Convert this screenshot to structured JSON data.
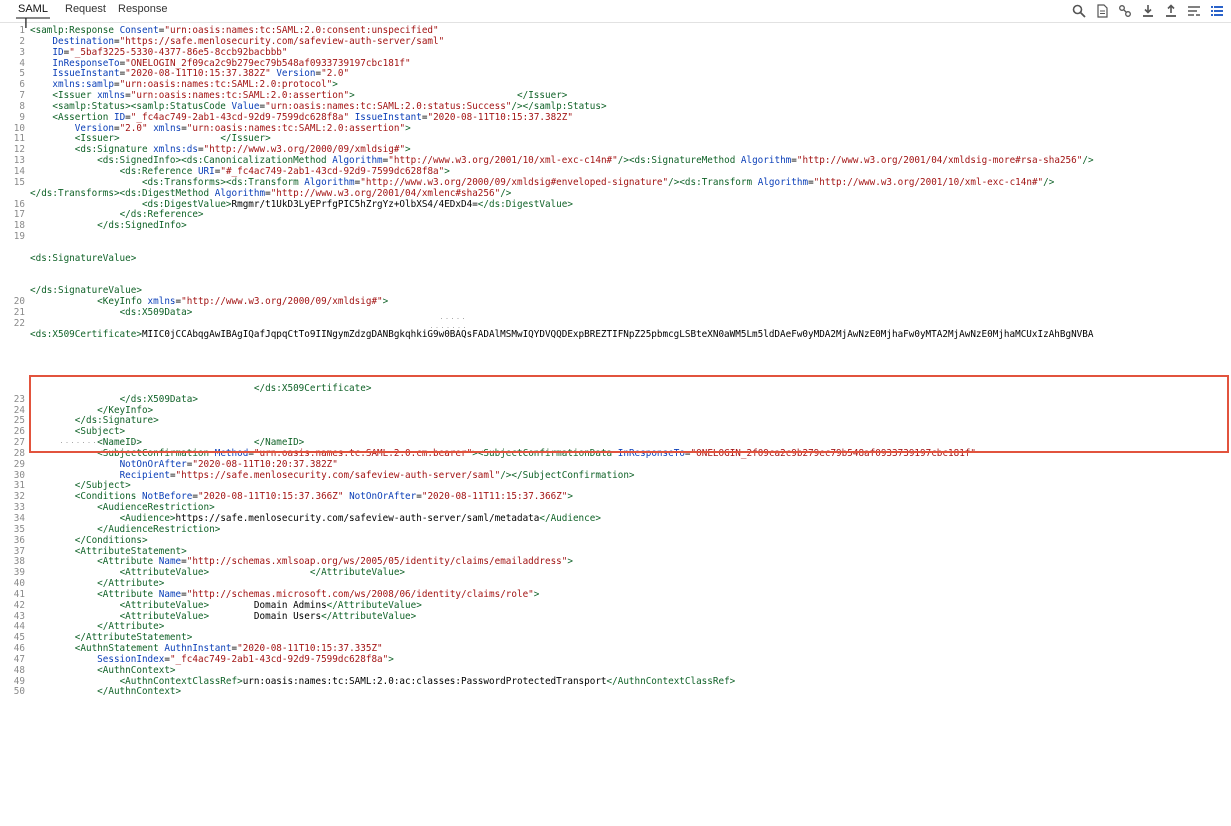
{
  "tabs": [
    {
      "label": "SAML",
      "active": true
    },
    {
      "label": "Request",
      "active": false
    },
    {
      "label": "Response",
      "active": false
    }
  ],
  "toolbar": [
    "search-icon",
    "document-icon",
    "link-icon",
    "download-icon",
    "upload-icon",
    "wrap-icon",
    "list-icon"
  ],
  "colors": {
    "tag": "#116329",
    "attr": "#0b3fb8",
    "value": "#a31515",
    "highlight": "#e2533d",
    "line_number": "#8a8a8a"
  },
  "lines": [
    {
      "n": "1",
      "s": [
        [
          "t",
          "<samlp:Response "
        ],
        [
          "a",
          "Consent"
        ],
        [
          "k",
          "="
        ],
        [
          "v",
          "\"urn:oasis:names:tc:SAML:2.0:consent:unspecified\""
        ]
      ]
    },
    {
      "n": "2",
      "s": [
        [
          "k",
          "    "
        ],
        [
          "a",
          "Destination"
        ],
        [
          "k",
          "="
        ],
        [
          "v",
          "\"https://safe.menlosecurity.com/safeview-auth-server/saml\""
        ]
      ]
    },
    {
      "n": "3",
      "s": [
        [
          "k",
          "    "
        ],
        [
          "a",
          "ID"
        ],
        [
          "k",
          "="
        ],
        [
          "v",
          "\"_5baf3225-5330-4377-86e5-8ccb92bacbbb\""
        ]
      ]
    },
    {
      "n": "4",
      "s": [
        [
          "k",
          "    "
        ],
        [
          "a",
          "InResponseTo"
        ],
        [
          "k",
          "="
        ],
        [
          "v",
          "\"ONELOGIN_2f09ca2c9b279ec79b548af0933739197cbc181f\""
        ]
      ]
    },
    {
      "n": "5",
      "s": [
        [
          "k",
          "    "
        ],
        [
          "a",
          "IssueInstant"
        ],
        [
          "k",
          "="
        ],
        [
          "v",
          "\"2020-08-11T10:15:37.382Z\""
        ],
        [
          "k",
          " "
        ],
        [
          "a",
          "Version"
        ],
        [
          "k",
          "="
        ],
        [
          "v",
          "\"2.0\""
        ]
      ]
    },
    {
      "n": "6",
      "s": [
        [
          "k",
          "    "
        ],
        [
          "a",
          "xmlns:samlp"
        ],
        [
          "k",
          "="
        ],
        [
          "v",
          "\"urn:oasis:names:tc:SAML:2.0:protocol\""
        ],
        [
          "t",
          ">"
        ]
      ]
    },
    {
      "n": "7",
      "s": [
        [
          "k",
          "    "
        ],
        [
          "t",
          "<Issuer "
        ],
        [
          "a",
          "xmlns"
        ],
        [
          "k",
          "="
        ],
        [
          "v",
          "\"urn:oasis:names:tc:SAML:2.0:assertion\""
        ],
        [
          "t",
          ">"
        ],
        [
          "k",
          "                             "
        ],
        [
          "t",
          "</Issuer>"
        ]
      ]
    },
    {
      "n": "8",
      "s": [
        [
          "k",
          "    "
        ],
        [
          "t",
          "<samlp:Status><samlp:StatusCode "
        ],
        [
          "a",
          "Value"
        ],
        [
          "k",
          "="
        ],
        [
          "v",
          "\"urn:oasis:names:tc:SAML:2.0:status:Success\""
        ],
        [
          "t",
          "/></samlp:Status>"
        ]
      ]
    },
    {
      "n": "9",
      "s": [
        [
          "k",
          "    "
        ],
        [
          "t",
          "<Assertion "
        ],
        [
          "a",
          "ID"
        ],
        [
          "k",
          "="
        ],
        [
          "v",
          "\"_fc4ac749-2ab1-43cd-92d9-7599dc628f8a\""
        ],
        [
          "k",
          " "
        ],
        [
          "a",
          "IssueInstant"
        ],
        [
          "k",
          "="
        ],
        [
          "v",
          "\"2020-08-11T10:15:37.382Z\""
        ]
      ]
    },
    {
      "n": "10",
      "s": [
        [
          "k",
          "        "
        ],
        [
          "a",
          "Version"
        ],
        [
          "k",
          "="
        ],
        [
          "v",
          "\"2.0\""
        ],
        [
          "k",
          " "
        ],
        [
          "a",
          "xmlns"
        ],
        [
          "k",
          "="
        ],
        [
          "v",
          "\"urn:oasis:names:tc:SAML:2.0:assertion\""
        ],
        [
          "t",
          ">"
        ]
      ]
    },
    {
      "n": "11",
      "s": [
        [
          "k",
          "        "
        ],
        [
          "t",
          "<Issuer>"
        ],
        [
          "k",
          "                  "
        ],
        [
          "t",
          "</Issuer>"
        ]
      ]
    },
    {
      "n": "12",
      "s": [
        [
          "k",
          "        "
        ],
        [
          "t",
          "<ds:Signature "
        ],
        [
          "a",
          "xmlns:ds"
        ],
        [
          "k",
          "="
        ],
        [
          "v",
          "\"http://www.w3.org/2000/09/xmldsig#\""
        ],
        [
          "t",
          ">"
        ]
      ]
    },
    {
      "n": "13",
      "s": [
        [
          "k",
          "            "
        ],
        [
          "t",
          "<ds:SignedInfo><ds:CanonicalizationMethod "
        ],
        [
          "a",
          "Algorithm"
        ],
        [
          "k",
          "="
        ],
        [
          "v",
          "\"http://www.w3.org/2001/10/xml-exc-c14n#\""
        ],
        [
          "t",
          "/><ds:SignatureMethod "
        ],
        [
          "a",
          "Algorithm"
        ],
        [
          "k",
          "="
        ],
        [
          "v",
          "\"http://www.w3.org/2001/04/xmldsig-more#rsa-sha256\""
        ],
        [
          "t",
          "/>"
        ]
      ]
    },
    {
      "n": "14",
      "s": [
        [
          "k",
          "                "
        ],
        [
          "t",
          "<ds:Reference "
        ],
        [
          "a",
          "URI"
        ],
        [
          "k",
          "="
        ],
        [
          "v",
          "\"#_fc4ac749-2ab1-43cd-92d9-7599dc628f8a\""
        ],
        [
          "t",
          ">"
        ]
      ]
    },
    {
      "n": "15",
      "s": [
        [
          "k",
          "                    "
        ],
        [
          "t",
          "<ds:Transforms><ds:Transform "
        ],
        [
          "a",
          "Algorithm"
        ],
        [
          "k",
          "="
        ],
        [
          "v",
          "\"http://www.w3.org/2000/09/xmldsig#enveloped-signature\""
        ],
        [
          "t",
          "/><ds:Transform "
        ],
        [
          "a",
          "Algorithm"
        ],
        [
          "k",
          "="
        ],
        [
          "v",
          "\"http://www.w3.org/2001/10/xml-exc-c14n#\""
        ],
        [
          "t",
          "/>"
        ]
      ]
    },
    {
      "n": "",
      "s": [
        [
          "t",
          "</ds:Transforms><ds:DigestMethod "
        ],
        [
          "a",
          "Algorithm"
        ],
        [
          "k",
          "="
        ],
        [
          "v",
          "\"http://www.w3.org/2001/04/xmlenc#sha256\""
        ],
        [
          "t",
          "/>"
        ]
      ]
    },
    {
      "n": "16",
      "s": [
        [
          "k",
          "                    "
        ],
        [
          "t",
          "<ds:DigestValue>"
        ],
        [
          "k",
          "Rmgmr/t1UkD3LyEPrfgPIC5hZrgYz+OlbXS4/4EDxD4="
        ],
        [
          "t",
          "</ds:DigestValue>"
        ]
      ]
    },
    {
      "n": "17",
      "s": [
        [
          "k",
          "                "
        ],
        [
          "t",
          "</ds:Reference>"
        ]
      ]
    },
    {
      "n": "18",
      "s": [
        [
          "k",
          "            "
        ],
        [
          "t",
          "</ds:SignedInfo>"
        ]
      ]
    },
    {
      "n": "19",
      "s": []
    },
    {
      "n": "",
      "s": []
    },
    {
      "n": "",
      "s": [
        [
          "t",
          "<ds:SignatureValue>"
        ]
      ]
    },
    {
      "n": "",
      "s": []
    },
    {
      "n": "",
      "s": []
    },
    {
      "n": "",
      "s": [
        [
          "t",
          "</ds:SignatureValue>"
        ]
      ]
    },
    {
      "n": "20",
      "s": [
        [
          "k",
          "            "
        ],
        [
          "t",
          "<KeyInfo "
        ],
        [
          "a",
          "xmlns"
        ],
        [
          "k",
          "="
        ],
        [
          "v",
          "\"http://www.w3.org/2000/09/xmldsig#\""
        ],
        [
          "t",
          ">"
        ]
      ]
    },
    {
      "n": "21",
      "s": [
        [
          "k",
          "                "
        ],
        [
          "t",
          "<ds:X509Data>"
        ]
      ]
    },
    {
      "n": "22",
      "s": []
    },
    {
      "n": "",
      "s": [
        [
          "t",
          "<ds:X509Certificate>"
        ],
        [
          "k",
          "MIIC0jCCAbqgAwIBAgIQafJqpqCtTo9IINgymZdzgDANBgkqhkiG9w0BAQsFADAlMSMwIQYDVQQDExpBREZTIFNpZ25pbmcgLSBteXN0aWM5Lm5ldDAeFw0yMDA2MjAwNzE0MjhaFw0yMTA2MjAwNzE0MjhaMCUxIzAhBgNVBA"
        ]
      ]
    },
    {
      "n": "",
      "s": []
    },
    {
      "n": "",
      "s": []
    },
    {
      "n": "",
      "s": []
    },
    {
      "n": "",
      "s": []
    },
    {
      "n": "",
      "s": [
        [
          "k",
          "                                        "
        ],
        [
          "t",
          "</ds:X509Certificate>"
        ]
      ]
    },
    {
      "n": "23",
      "s": [
        [
          "k",
          "                "
        ],
        [
          "t",
          "</ds:X509Data>"
        ]
      ]
    },
    {
      "n": "24",
      "s": [
        [
          "k",
          "            "
        ],
        [
          "t",
          "</KeyInfo>"
        ]
      ]
    },
    {
      "n": "25",
      "s": [
        [
          "k",
          "        "
        ],
        [
          "t",
          "</ds:Signature>"
        ]
      ]
    },
    {
      "n": "26",
      "s": [
        [
          "k",
          "        "
        ],
        [
          "t",
          "<Subject>"
        ]
      ]
    },
    {
      "n": "27",
      "s": [
        [
          "k",
          "            "
        ],
        [
          "t",
          "<NameID>"
        ],
        [
          "k",
          "                    "
        ],
        [
          "t",
          "</NameID>"
        ]
      ]
    },
    {
      "n": "28",
      "s": [
        [
          "k",
          "            "
        ],
        [
          "t",
          "<SubjectConfirmation "
        ],
        [
          "a",
          "Method"
        ],
        [
          "k",
          "="
        ],
        [
          "v",
          "\"urn:oasis:names:tc:SAML:2.0:cm:bearer\""
        ],
        [
          "t",
          "><SubjectConfirmationData "
        ],
        [
          "a",
          "InResponseTo"
        ],
        [
          "k",
          "="
        ],
        [
          "v",
          "\"ONELOGIN_2f09ca2c9b279ec79b548af0933739197cbc181f\""
        ]
      ]
    },
    {
      "n": "29",
      "s": [
        [
          "k",
          "                "
        ],
        [
          "a",
          "NotOnOrAfter"
        ],
        [
          "k",
          "="
        ],
        [
          "v",
          "\"2020-08-11T10:20:37.382Z\""
        ]
      ]
    },
    {
      "n": "30",
      "s": [
        [
          "k",
          "                "
        ],
        [
          "a",
          "Recipient"
        ],
        [
          "k",
          "="
        ],
        [
          "v",
          "\"https://safe.menlosecurity.com/safeview-auth-server/saml\""
        ],
        [
          "t",
          "/></SubjectConfirmation>"
        ]
      ]
    },
    {
      "n": "31",
      "s": [
        [
          "k",
          "        "
        ],
        [
          "t",
          "</Subject>"
        ]
      ]
    },
    {
      "n": "32",
      "s": [
        [
          "k",
          "        "
        ],
        [
          "t",
          "<Conditions "
        ],
        [
          "a",
          "NotBefore"
        ],
        [
          "k",
          "="
        ],
        [
          "v",
          "\"2020-08-11T10:15:37.366Z\""
        ],
        [
          "k",
          " "
        ],
        [
          "a",
          "NotOnOrAfter"
        ],
        [
          "k",
          "="
        ],
        [
          "v",
          "\"2020-08-11T11:15:37.366Z\""
        ],
        [
          "t",
          ">"
        ]
      ]
    },
    {
      "n": "33",
      "s": [
        [
          "k",
          "            "
        ],
        [
          "t",
          "<AudienceRestriction>"
        ]
      ]
    },
    {
      "n": "34",
      "s": [
        [
          "k",
          "                "
        ],
        [
          "t",
          "<Audience>"
        ],
        [
          "k",
          "https://safe.menlosecurity.com/safeview-auth-server/saml/metadata"
        ],
        [
          "t",
          "</Audience>"
        ]
      ]
    },
    {
      "n": "35",
      "s": [
        [
          "k",
          "            "
        ],
        [
          "t",
          "</AudienceRestriction>"
        ]
      ]
    },
    {
      "n": "36",
      "s": [
        [
          "k",
          "        "
        ],
        [
          "t",
          "</Conditions>"
        ]
      ]
    },
    {
      "n": "37",
      "s": [
        [
          "k",
          "        "
        ],
        [
          "t",
          "<AttributeStatement>"
        ]
      ]
    },
    {
      "n": "38",
      "s": [
        [
          "k",
          "            "
        ],
        [
          "t",
          "<Attribute "
        ],
        [
          "a",
          "Name"
        ],
        [
          "k",
          "="
        ],
        [
          "v",
          "\"http://schemas.xmlsoap.org/ws/2005/05/identity/claims/emailaddress\""
        ],
        [
          "t",
          ">"
        ]
      ]
    },
    {
      "n": "39",
      "s": [
        [
          "k",
          "                "
        ],
        [
          "t",
          "<AttributeValue>"
        ],
        [
          "k",
          "                  "
        ],
        [
          "t",
          "</AttributeValue>"
        ]
      ]
    },
    {
      "n": "40",
      "s": [
        [
          "k",
          "            "
        ],
        [
          "t",
          "</Attribute>"
        ]
      ]
    },
    {
      "n": "41",
      "s": [
        [
          "k",
          "            "
        ],
        [
          "t",
          "<Attribute "
        ],
        [
          "a",
          "Name"
        ],
        [
          "k",
          "="
        ],
        [
          "v",
          "\"http://schemas.microsoft.com/ws/2008/06/identity/claims/role\""
        ],
        [
          "t",
          ">"
        ]
      ]
    },
    {
      "n": "42",
      "s": [
        [
          "k",
          "                "
        ],
        [
          "t",
          "<AttributeValue>"
        ],
        [
          "k",
          "        Domain Admins"
        ],
        [
          "t",
          "</AttributeValue>"
        ]
      ]
    },
    {
      "n": "43",
      "s": [
        [
          "k",
          "                "
        ],
        [
          "t",
          "<AttributeValue>"
        ],
        [
          "k",
          "        Domain Users"
        ],
        [
          "t",
          "</AttributeValue>"
        ]
      ]
    },
    {
      "n": "44",
      "s": [
        [
          "k",
          "            "
        ],
        [
          "t",
          "</Attribute>"
        ]
      ]
    },
    {
      "n": "45",
      "s": [
        [
          "k",
          "        "
        ],
        [
          "t",
          "</AttributeStatement>"
        ]
      ]
    },
    {
      "n": "46",
      "s": [
        [
          "k",
          "        "
        ],
        [
          "t",
          "<AuthnStatement "
        ],
        [
          "a",
          "AuthnInstant"
        ],
        [
          "k",
          "="
        ],
        [
          "v",
          "\"2020-08-11T10:15:37.335Z\""
        ]
      ]
    },
    {
      "n": "47",
      "s": [
        [
          "k",
          "            "
        ],
        [
          "a",
          "SessionIndex"
        ],
        [
          "k",
          "="
        ],
        [
          "v",
          "\"_fc4ac749-2ab1-43cd-92d9-7599dc628f8a\""
        ],
        [
          "t",
          ">"
        ]
      ]
    },
    {
      "n": "48",
      "s": [
        [
          "k",
          "            "
        ],
        [
          "t",
          "<AuthnContext>"
        ]
      ]
    },
    {
      "n": "49",
      "s": [
        [
          "k",
          "                "
        ],
        [
          "t",
          "<AuthnContextClassRef>"
        ],
        [
          "k",
          "urn:oasis:names:tc:SAML:2.0:ac:classes:PasswordProtectedTransport"
        ],
        [
          "t",
          "</AuthnContextClassRef>"
        ]
      ]
    },
    {
      "n": "50",
      "s": [
        [
          "k",
          "            "
        ],
        [
          "t",
          "</AuthnContext>"
        ]
      ]
    }
  ]
}
